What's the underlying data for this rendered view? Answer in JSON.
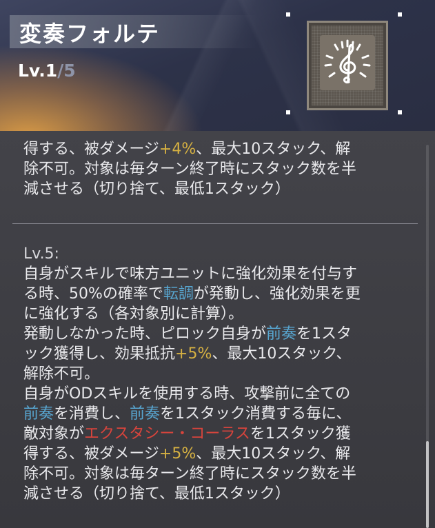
{
  "skill": {
    "name": "変奏フォルテ",
    "level_prefix": "Lv.",
    "level_current": "1",
    "level_sep": "/",
    "level_max": "5",
    "icon": "treble-clef-icon"
  },
  "description": {
    "prev_level_tail": [
      [
        {
          "t": "得する、被ダメージ"
        },
        {
          "t": "+4%",
          "c": "yel"
        },
        {
          "t": "、最大10スタック、解"
        }
      ],
      [
        {
          "t": "除不可。対象は毎ターン終了時にスタック数を半"
        }
      ],
      [
        {
          "t": "減させる（切り捨て、最低1スタック）"
        }
      ]
    ],
    "level5_label": "Lv.5:",
    "level5_lines": [
      [
        {
          "t": "自身がスキルで味方ユニットに強化効果を付与す"
        }
      ],
      [
        {
          "t": "る時、50%の確率で"
        },
        {
          "t": "転調",
          "c": "blu"
        },
        {
          "t": "が発動し、強化効果を更"
        }
      ],
      [
        {
          "t": "に強化する（各対象別に計算）。"
        }
      ],
      [
        {
          "t": "発動しなかった時、ピロック自身が"
        },
        {
          "t": "前奏",
          "c": "blu"
        },
        {
          "t": "を1スタ"
        }
      ],
      [
        {
          "t": "ック獲得し、効果抵抗"
        },
        {
          "t": "+5%",
          "c": "yel"
        },
        {
          "t": "、最大10スタック、"
        }
      ],
      [
        {
          "t": "解除不可。"
        }
      ],
      [
        {
          "t": "自身がODスキルを使用する時、攻撃前に全ての"
        }
      ],
      [
        {
          "t": "前奏",
          "c": "blu"
        },
        {
          "t": "を消費し、"
        },
        {
          "t": "前奏",
          "c": "blu"
        },
        {
          "t": "を1スタック消費する毎に、"
        }
      ],
      [
        {
          "t": "敵対象が"
        },
        {
          "t": "エクスタシー・コーラス",
          "c": "red"
        },
        {
          "t": "を1スタック獲"
        }
      ],
      [
        {
          "t": "得する、被ダメージ"
        },
        {
          "t": "+5%",
          "c": "yel"
        },
        {
          "t": "、最大10スタック、解"
        }
      ],
      [
        {
          "t": "除不可。対象は毎ターン終了時にスタック数を半"
        }
      ],
      [
        {
          "t": "減させる（切り捨て、最低1スタック）"
        }
      ]
    ]
  },
  "colors": {
    "highlight_yellow": "#d6b142",
    "highlight_blue": "#58a7d2",
    "highlight_red": "#d8443c"
  }
}
